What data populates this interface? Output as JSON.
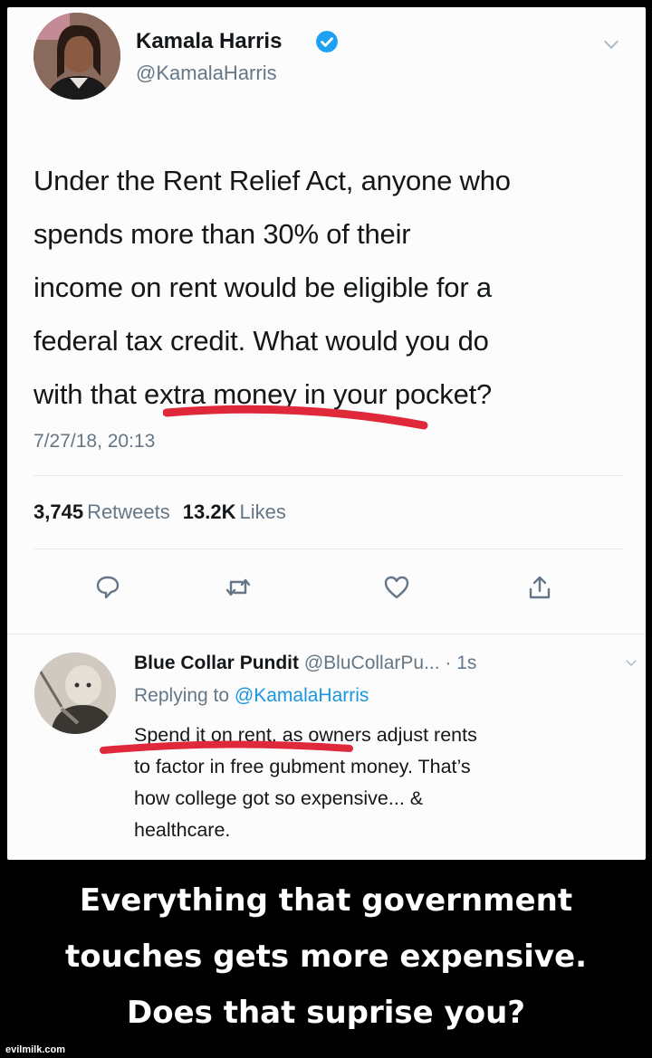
{
  "tweet": {
    "author": {
      "name": "Kamala Harris",
      "handle": "@KamalaHarris"
    },
    "text_lines": [
      "Under the Rent Relief Act, anyone who",
      "spends more than 30% of their",
      "income on rent would be eligible for a",
      "federal tax credit. What would you do",
      "with that extra money in your pocket?"
    ],
    "timestamp": "7/27/18, 20:13",
    "stats": {
      "retweets_count": "3,745",
      "retweets_label": "Retweets",
      "likes_count": "13.2K",
      "likes_label": "Likes"
    },
    "actions": [
      "reply-icon",
      "retweet-icon",
      "like-icon",
      "share-icon"
    ]
  },
  "reply": {
    "name": "Blue Collar Pundit",
    "handle": "@BluCollarPu...",
    "time": "· 1s",
    "replying_prefix": "Replying to",
    "replying_handle": "@KamalaHarris",
    "text_lines": [
      "Spend it on rent, as owners adjust rents",
      "to factor in free gubment money. That’s",
      "how college got so expensive... &",
      "healthcare."
    ]
  },
  "caption": {
    "lines": [
      "Everything that government",
      "touches gets more expensive.",
      "Does that suprise you?"
    ]
  },
  "watermark": "evilmilk.com",
  "colors": {
    "highlight": "#e0283b",
    "link": "#1b95e0",
    "verified": "#1da1f2",
    "muted": "#657786"
  }
}
